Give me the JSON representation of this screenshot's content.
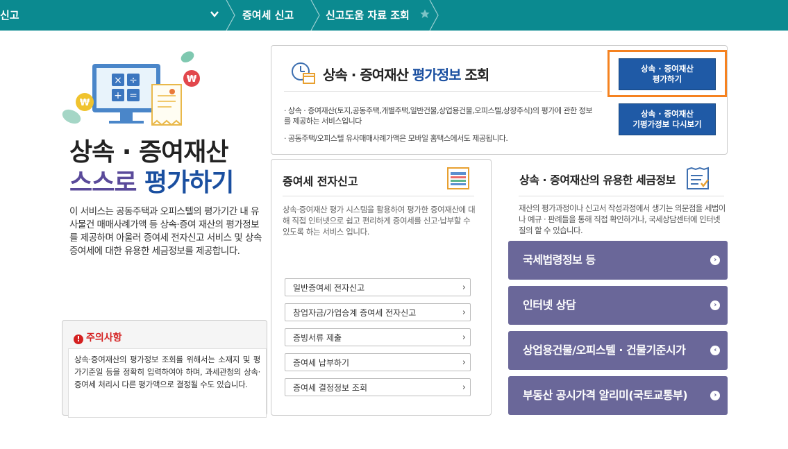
{
  "breadcrumb": {
    "item1": "신고",
    "item2": "증여세 신고",
    "item3": "신고도움 자료 조회",
    "chevron_icon": "chevron-down-icon",
    "star_icon": "star-icon"
  },
  "hero": {
    "title_line1": "상속 · 증여재산",
    "title_line2a": "스스로",
    "title_line2b": "평가하기",
    "description": "이 서비스는 공동주택과 오피스텔의 평가기간 내 유사물건 매매사례가액 등 상속·증여 재산의 평가정보를 제공하며 아울러 증여세 전자신고 서비스 및 상속증여세에 대한 유용한 세금정보를 제공합니다."
  },
  "caution": {
    "title": "주의사항",
    "body": "상속·증여재산의 평가정보 조회를 위해서는 소재지 및 평가기준일 등을 정확히 입력하여야 하며, 과세관청의 상속·증여세 처리시 다른 평가액으로 결정될 수도 있습니다."
  },
  "evaluation": {
    "title_pre": "상속 · 증여재산 ",
    "title_hl": "평가정보",
    "title_post": " 조회",
    "bullet1": "· 상속 · 증여재산(토지,공동주택,개별주택,일반건물,상업용건물,오피스텔,상장주식)의 평가에 관한 정보를 제공하는 서비스입니다",
    "bullet2": "· 공동주택/오피스텔 유사매매사례가액은 모바일 홈택스에서도 제공됩니다.",
    "btn_evaluate_l1": "상속 · 증여재산",
    "btn_evaluate_l2": "평가하기",
    "btn_review_l1": "상속 · 증여재산",
    "btn_review_l2": "기평가정보 다시보기"
  },
  "efile": {
    "title": "증여세 전자신고",
    "description": "상속·증여재산 평가 시스템을 활용하여 평가한 증여재산에 대해 직접 인터넷으로 쉽고 편리하게 증여세를 신고·납부할 수 있도록 하는 서비스 입니다.",
    "links": [
      "일반증여세 전자신고",
      "창업자금/가업승계 증여세 전자신고",
      "증빙서류 제출",
      "증여세 납부하기",
      "증여세 결정정보 조회"
    ]
  },
  "taxinfo": {
    "title": "상속 · 증여재산의 유용한 세금정보",
    "description": "재산의 평가과정이나 신고서 작성과정에서 생기는 의문점을 세법이나 예규 · 판례들을 통해 직접 확인하거나, 국세상담센터에 인터넷 질의 할 수 있습니다.",
    "buttons": [
      "국세법령정보 등",
      "인터넷 상담",
      "상업용건물/오피스텔 · 건물기준시가",
      "부동산 공시가격 알리미(국토교통부)"
    ]
  },
  "colors": {
    "topbar": "#0b8a90",
    "accent_blue": "#1f5aa6",
    "purple_btn": "#6a6799",
    "highlight_orange": "#f58220",
    "caution_red": "#d42020"
  }
}
